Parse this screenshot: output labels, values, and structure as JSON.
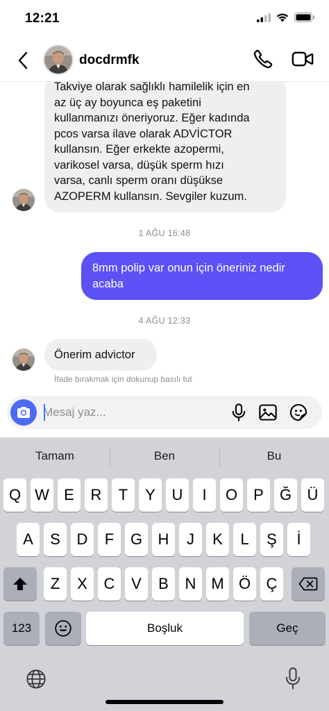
{
  "status_bar": {
    "time": "12:21"
  },
  "header": {
    "username": "docdrmfk"
  },
  "messages": {
    "incoming_1": {
      "lines": [
        "Takviye olarak sağlıklı hamilelik için en",
        "az üç ay boyunca eş paketini",
        "kullanmanızı öneriyoruz. Eğer kadında",
        "pcos varsa ilave olarak ADVİCTOR",
        "kullansın. Eğer erkekte azopermi,",
        "varikosel varsa, düşük sperm hızı",
        "varsa, canlı sperm oranı düşükse",
        "AZOPERM kullansın. Sevgiler kuzum."
      ]
    },
    "timestamp_1": "1 AĞU 16:48",
    "outgoing_1": {
      "lines": [
        "8mm polip var onun için öneriniz nedir",
        "acaba"
      ]
    },
    "timestamp_2": "4 AĞU 12:33",
    "incoming_2": {
      "text": "Önerim advictor"
    },
    "reaction_hint": "İfade bırakmak için dokunup basılı tut"
  },
  "composer": {
    "placeholder": "Mesaj yaz..."
  },
  "keyboard": {
    "suggestions": [
      "Tamam",
      "Ben",
      "Bu"
    ],
    "row1": [
      "Q",
      "W",
      "E",
      "R",
      "T",
      "Y",
      "U",
      "I",
      "O",
      "P",
      "Ğ",
      "Ü"
    ],
    "row2": [
      "A",
      "S",
      "D",
      "F",
      "G",
      "H",
      "J",
      "K",
      "L",
      "Ş",
      "İ"
    ],
    "row3": [
      "Z",
      "X",
      "C",
      "V",
      "B",
      "N",
      "M",
      "Ö",
      "Ç"
    ],
    "numbers_label": "123",
    "space_label": "Boşluk",
    "return_label": "Geç"
  },
  "colors": {
    "outgoing_bubble": "#5b51f5",
    "incoming_bubble": "#efefef",
    "camera_button": "#4b6bf4",
    "keyboard_bg": "#d1d3d9"
  },
  "icons": [
    "back-icon",
    "phone-icon",
    "video-icon",
    "camera-icon",
    "microphone-icon",
    "image-icon",
    "sticker-icon",
    "shift-icon",
    "delete-icon",
    "emoji-icon",
    "globe-icon",
    "dictation-icon"
  ]
}
